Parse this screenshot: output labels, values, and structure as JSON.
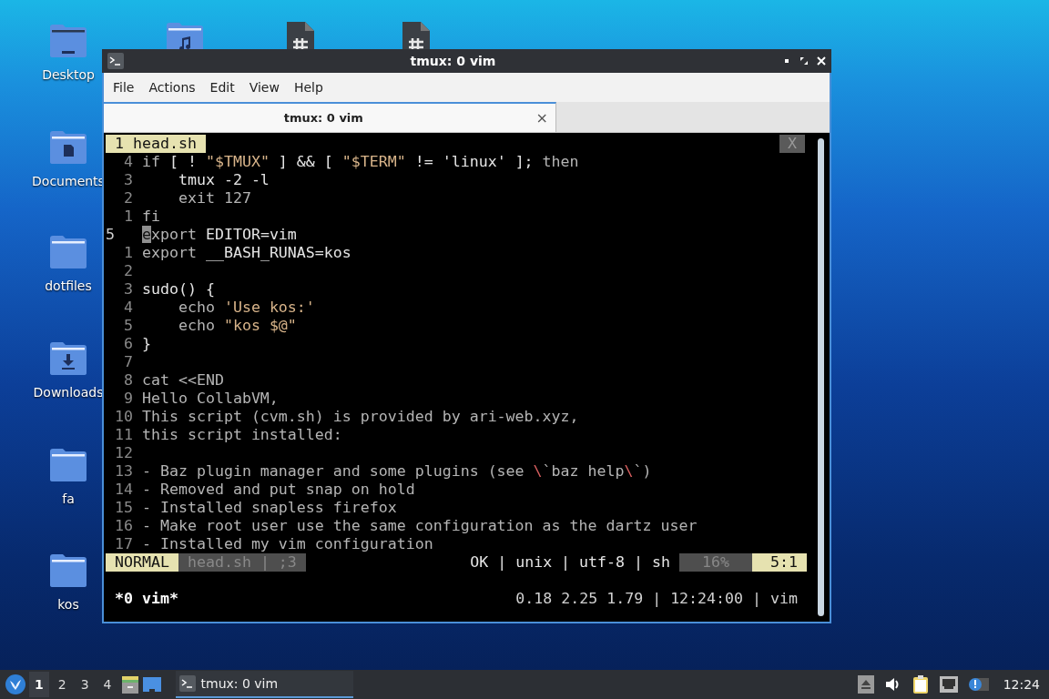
{
  "desktop_icons": [
    {
      "label": "Desktop",
      "kind": "desktop"
    },
    {
      "label": "Documents",
      "kind": "documents"
    },
    {
      "label": "dotfiles",
      "kind": "folder"
    },
    {
      "label": "Downloads",
      "kind": "downloads"
    },
    {
      "label": "fa",
      "kind": "folder"
    },
    {
      "label": "kos",
      "kind": "folder"
    }
  ],
  "hidden_icons": [
    {
      "kind": "music"
    },
    {
      "kind": "file"
    },
    {
      "kind": "file"
    }
  ],
  "window": {
    "title": "tmux: 0 vim",
    "menu": [
      "File",
      "Actions",
      "Edit",
      "View",
      "Help"
    ],
    "tabs": [
      {
        "label": "tmux: 0 vim",
        "selected": true,
        "close": "×"
      }
    ],
    "terminal": {
      "buffer_tab": {
        "label": "1 head.sh",
        "close": "X"
      },
      "lines": [
        {
          "number": "4",
          "current": false,
          "segments": [
            {
              "kind": "keyword",
              "text": "if"
            },
            {
              "kind": "plain",
              "text": " [ ! "
            },
            {
              "kind": "string",
              "text": "\"$TMUX\""
            },
            {
              "kind": "plain",
              "text": " ] && [ "
            },
            {
              "kind": "string",
              "text": "\"$TERM\""
            },
            {
              "kind": "plain",
              "text": " != 'linux' ]; "
            },
            {
              "kind": "keyword",
              "text": "then"
            }
          ]
        },
        {
          "number": "3",
          "current": false,
          "segments": [
            {
              "kind": "plain",
              "text": "    tmux -2 -l"
            }
          ]
        },
        {
          "number": "2",
          "current": false,
          "segments": [
            {
              "kind": "keyword",
              "text": "    exit 127"
            }
          ]
        },
        {
          "number": "1",
          "current": false,
          "segments": [
            {
              "kind": "keyword",
              "text": "fi"
            }
          ]
        },
        {
          "number": "5",
          "current": true,
          "segments": [
            {
              "kind": "cursor",
              "text": "e"
            },
            {
              "kind": "keyword",
              "text": "xport"
            },
            {
              "kind": "plain",
              "text": " EDITOR=vim"
            }
          ]
        },
        {
          "number": "1",
          "current": false,
          "segments": [
            {
              "kind": "keyword",
              "text": "export"
            },
            {
              "kind": "plain",
              "text": " __BASH_RUNAS=kos"
            }
          ]
        },
        {
          "number": "2",
          "current": false
        },
        {
          "number": "3",
          "current": false,
          "segments": [
            {
              "kind": "plain",
              "text": "sudo() {"
            }
          ]
        },
        {
          "number": "4",
          "current": false,
          "segments": [
            {
              "kind": "keyword",
              "text": "    echo"
            },
            {
              "kind": "string",
              "text": " 'Use kos:'"
            }
          ]
        },
        {
          "number": "5",
          "current": false,
          "segments": [
            {
              "kind": "keyword",
              "text": "    echo"
            },
            {
              "kind": "string",
              "text": " \"kos $@\""
            }
          ]
        },
        {
          "number": "6",
          "current": false,
          "segments": [
            {
              "kind": "plain",
              "text": "}"
            }
          ]
        },
        {
          "number": "7",
          "current": false
        },
        {
          "number": "8",
          "current": false,
          "segments": [
            {
              "kind": "keyword",
              "text": "cat <<END"
            }
          ]
        },
        {
          "number": "9",
          "current": false,
          "segments": [
            {
              "kind": "keyword",
              "text": "Hello CollabVM,"
            }
          ]
        },
        {
          "number": "10",
          "current": false,
          "segments": [
            {
              "kind": "keyword",
              "text": "This script (cvm.sh) is provided by ari-web.xyz,"
            }
          ]
        },
        {
          "number": "11",
          "current": false,
          "segments": [
            {
              "kind": "keyword",
              "text": "this script installed:"
            }
          ]
        },
        {
          "number": "12",
          "current": false
        },
        {
          "number": "13",
          "current": false,
          "segments": [
            {
              "kind": "keyword",
              "text": "- Baz plugin manager and some plugins (see "
            },
            {
              "kind": "special",
              "text": "\\"
            },
            {
              "kind": "keyword",
              "text": "`baz help"
            },
            {
              "kind": "special",
              "text": "\\"
            },
            {
              "kind": "keyword",
              "text": "`)"
            }
          ]
        },
        {
          "number": "14",
          "current": false,
          "segments": [
            {
              "kind": "keyword",
              "text": "- Removed and put snap on hold"
            }
          ]
        },
        {
          "number": "15",
          "current": false,
          "segments": [
            {
              "kind": "keyword",
              "text": "- Installed snapless firefox"
            }
          ]
        },
        {
          "number": "16",
          "current": false,
          "segments": [
            {
              "kind": "keyword",
              "text": "- Make root user use the same configuration as the dartz user"
            }
          ]
        },
        {
          "number": "17",
          "current": false,
          "segments": [
            {
              "kind": "keyword",
              "text": "- Installed my vim configuration"
            }
          ]
        }
      ],
      "statusline": {
        "mode": "NORMAL",
        "file": "head.sh | ;3",
        "info": "OK | unix | utf-8 | sh",
        "percent": "16%",
        "position": "5:1"
      },
      "tmux_status": {
        "left": "*0 vim*",
        "right": "0.18 2.25 1.79 | 12:24:00 | vim"
      }
    }
  },
  "taskbar": {
    "workspaces": [
      {
        "label": "1",
        "selected": true
      },
      {
        "label": "2",
        "selected": false
      },
      {
        "label": "3",
        "selected": false
      },
      {
        "label": "4",
        "selected": false
      }
    ],
    "tasks": [
      {
        "label": "tmux: 0 vim",
        "selected": true
      }
    ],
    "clock": "12:24"
  }
}
